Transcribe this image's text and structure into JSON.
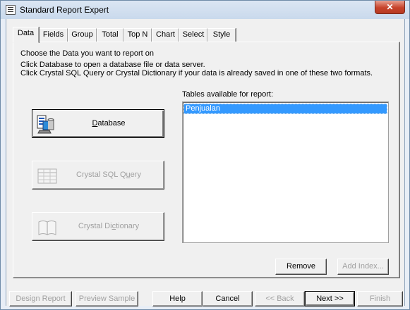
{
  "window": {
    "title": "Standard Report Expert",
    "close_glyph": "✕"
  },
  "tabs": [
    "Data",
    "Fields",
    "Group",
    "Total",
    "Top N",
    "Chart",
    "Select",
    "Style"
  ],
  "instructions": [
    "Choose the Data you want to report on",
    "Click Database to open a database file or data server.",
    "Click Crystal SQL Query or Crystal Dictionary if your data is already saved in one of these two formats."
  ],
  "source_buttons": {
    "database": {
      "label_pre": "",
      "label_ul": "D",
      "label_post": "atabase",
      "icon": "database-icon"
    },
    "sql_query": {
      "label_pre": "Crystal SQL Q",
      "label_ul": "u",
      "label_post": "ery",
      "icon": "sql-query-icon"
    },
    "dictionary": {
      "label_pre": "Crystal Di",
      "label_ul": "c",
      "label_post": "tionary",
      "icon": "dictionary-icon"
    }
  },
  "tables": {
    "label": "Tables available for report:",
    "items": [
      "Penjualan"
    ]
  },
  "panel_buttons": {
    "remove": "Remove",
    "add_index": "Add Index..."
  },
  "footer": {
    "design_report": "Design Report",
    "preview_sample": "Preview Sample",
    "help": "Help",
    "cancel": "Cancel",
    "back": "<< Back",
    "next": "Next >>",
    "finish": "Finish"
  }
}
